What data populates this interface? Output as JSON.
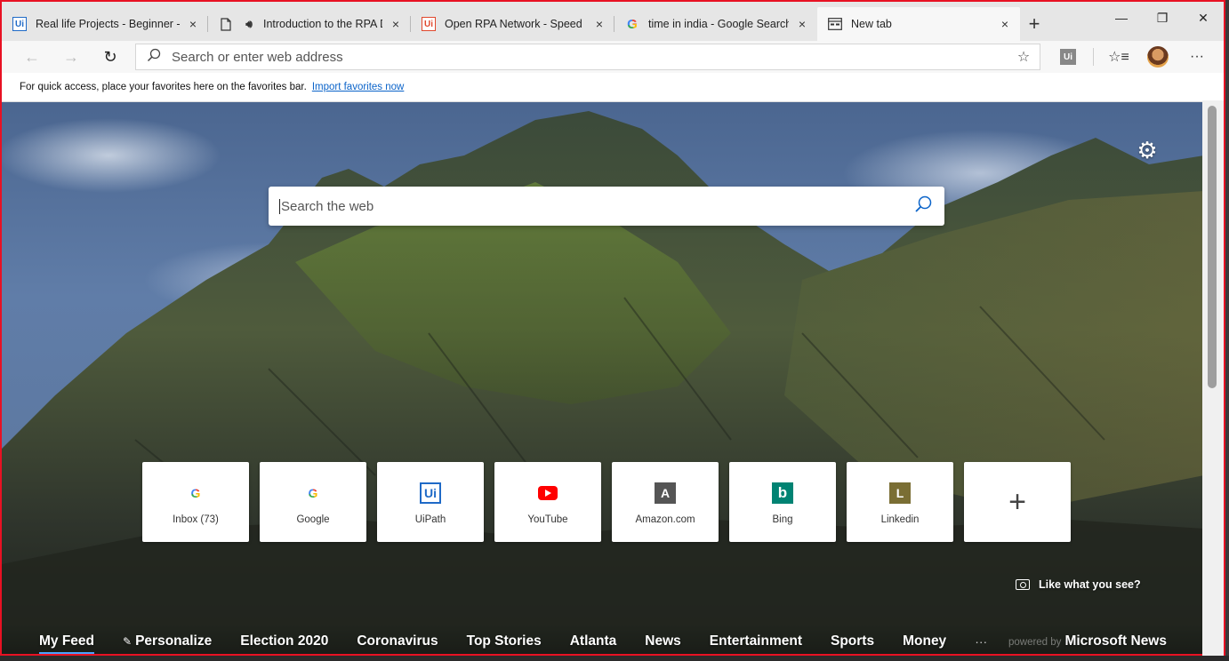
{
  "tabs": [
    {
      "title": "Real life Projects - Beginner - E",
      "favicon": "uipath-icon",
      "close": "×"
    },
    {
      "title": "Introduction to the RPA D",
      "favicon": "page-icon",
      "audio": "speaker-icon",
      "close": "×"
    },
    {
      "title": "Open RPA Network - Speed Up",
      "favicon": "uipath-red-icon",
      "close": "×"
    },
    {
      "title": "time in india - Google Search",
      "favicon": "google-icon",
      "close": "×"
    },
    {
      "title": "New tab",
      "favicon": "newtab-icon",
      "close": "×",
      "active": true
    }
  ],
  "window_controls": {
    "minimize": "—",
    "restore": "❐",
    "close": "✕"
  },
  "toolbar": {
    "back": "←",
    "forward": "→",
    "refresh": "↻",
    "address_placeholder": "Search or enter web address",
    "more": "···",
    "extension_label": "Ui"
  },
  "favorites_bar": {
    "text": "For quick access, place your favorites here on the favorites bar.",
    "link": "Import favorites now"
  },
  "new_tab": {
    "search_placeholder": "Search the web",
    "quick_links": [
      {
        "label": "Inbox (73)",
        "icon": "google-icon",
        "glyph": "G"
      },
      {
        "label": "Google",
        "icon": "google-icon",
        "glyph": "G"
      },
      {
        "label": "UiPath",
        "icon": "uipath-icon",
        "glyph": "Ui"
      },
      {
        "label": "YouTube",
        "icon": "youtube-icon",
        "glyph": ""
      },
      {
        "label": "Amazon.com",
        "icon": "amazon-letter-icon",
        "glyph": "A",
        "color": "#555555"
      },
      {
        "label": "Bing",
        "icon": "bing-icon",
        "glyph": "b",
        "color": "#008373"
      },
      {
        "label": "Linkedin",
        "icon": "linkedin-letter-icon",
        "glyph": "L",
        "color": "#7a6e34"
      }
    ],
    "add_tile_glyph": "+",
    "like_what_you_see": "Like what you see?",
    "feed_nav": [
      {
        "label": "My Feed",
        "active": true
      },
      {
        "label": "Personalize",
        "pencil": true
      },
      {
        "label": "Election 2020"
      },
      {
        "label": "Coronavirus"
      },
      {
        "label": "Top Stories"
      },
      {
        "label": "Atlanta"
      },
      {
        "label": "News"
      },
      {
        "label": "Entertainment"
      },
      {
        "label": "Sports"
      },
      {
        "label": "Money"
      }
    ],
    "more_glyph": "···",
    "powered_by": "powered by",
    "news_brand": "Microsoft News"
  },
  "colors": {
    "window_border": "#e81123",
    "accent": "#0a63c9",
    "feed_underline": "#4aa3ff"
  }
}
